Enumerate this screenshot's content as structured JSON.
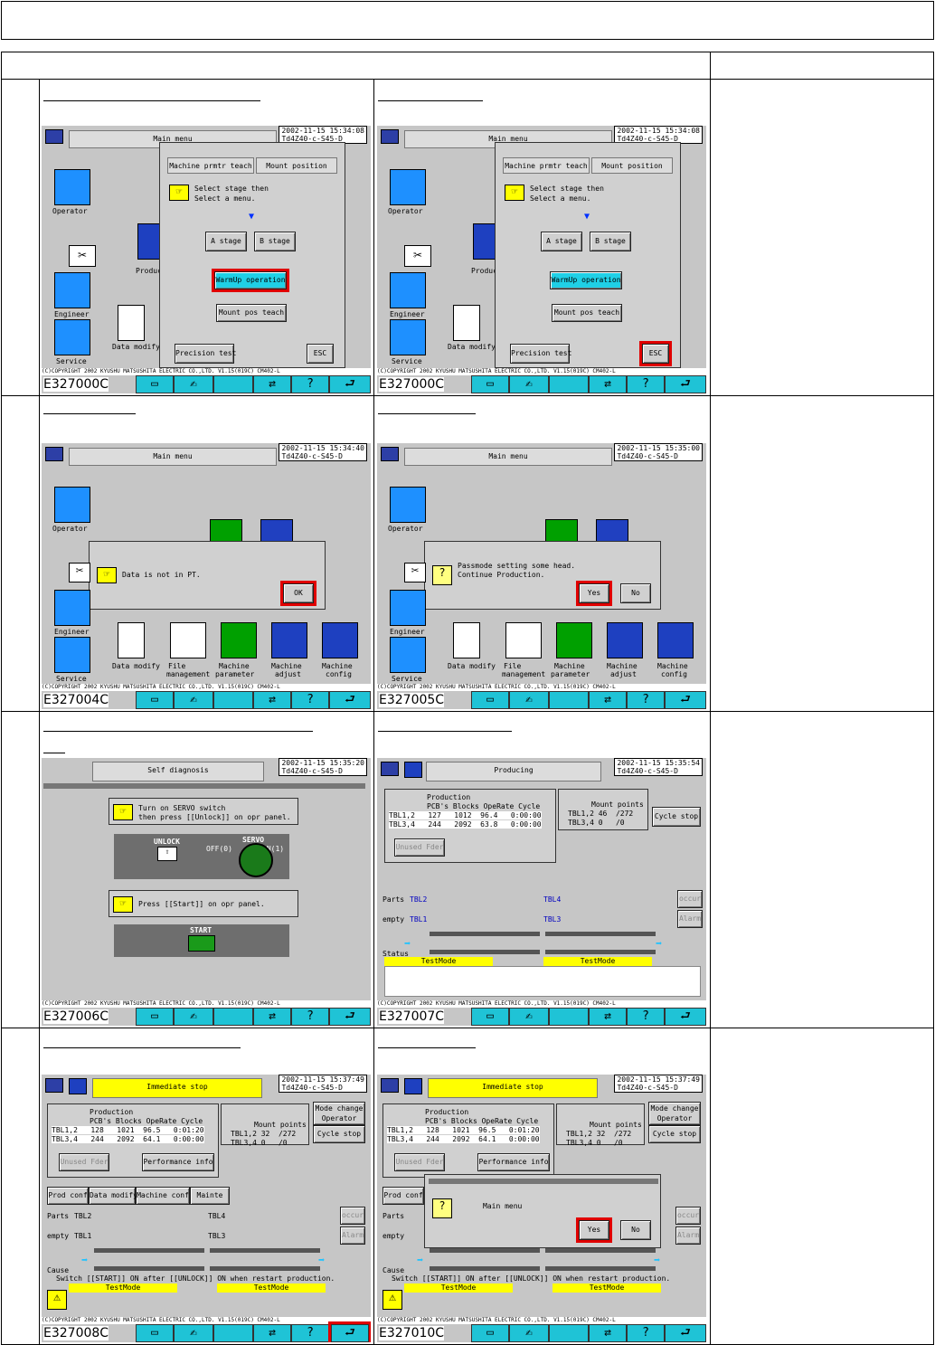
{
  "stamp_date": "2002-11-15",
  "copyright": "(C)COPYRIGHT 2002 KYUSHU MATSUSHITA ELECTRIC CO.,LTD. V1.15(019C)   CM402-L",
  "toolbar": {
    "help": "?",
    "transfer": "⇄",
    "return": "⮐",
    "pen": "✍"
  },
  "screens": [
    {
      "code": "E327000C",
      "time": "15:34:08",
      "file": "Td4Z40-c-S45-D",
      "main": "Main menu",
      "dialog": {
        "left": "Machine prmtr teach",
        "right": "Mount position",
        "msg1": "Select stage then",
        "msg2": "Select a menu.",
        "a": "A stage",
        "b": "B stage",
        "warm": "WarmUp operation",
        "teach": "Mount pos teach",
        "prec": "Precision test",
        "esc": "ESC"
      }
    },
    {
      "code": "E327000C",
      "time": "15:34:08",
      "file": "Td4Z40-c-S45-D",
      "main": "Main menu"
    },
    {
      "code": "E327004C",
      "time": "15:34:40",
      "file": "Td4Z40-c-S45-D",
      "main": "Main menu",
      "msg": "Data is not in PT.",
      "ok": "OK"
    },
    {
      "code": "E327005C",
      "time": "15:35:00",
      "file": "Td4Z40-c-S45-D",
      "main": "Main menu",
      "msg1": "Passmode setting some head.",
      "msg2": "Continue Production.",
      "yes": "Yes",
      "no": "No"
    },
    {
      "code": "E327006C",
      "time": "15:35:20",
      "file": "Td4Z40-c-S45-D",
      "title": "Self diagnosis",
      "msg1": "Turn on SERVO switch",
      "msg2": "then press [[Unlock]] on opr panel.",
      "unlock": "UNLOCK",
      "servo": "SERVO",
      "off": "OFF(0)",
      "on": "ON(1)",
      "msg3": "Press [[Start]] on opr panel.",
      "start": "START"
    },
    {
      "code": "E327007C",
      "time": "15:35:54",
      "file": "Td4Z40-c-S45-D",
      "title": "Producing"
    },
    {
      "code": "E327008C",
      "time": "15:37:49",
      "file": "Td4Z40-c-S45-D",
      "title": "Immediate stop"
    },
    {
      "code": "E327010C",
      "time": "15:37:49",
      "file": "Td4Z40-c-S45-D",
      "title": "Immediate stop",
      "dlgmsg": "Main menu",
      "yes": "Yes",
      "no": "No"
    }
  ],
  "icons": {
    "operator": "Operator",
    "engineer": "Engineer",
    "service": "Service",
    "datamod": "Data modify",
    "file1": "File",
    "file2": "management",
    "mp1": "Machine",
    "mp2": "parameter",
    "ma1": "Machine",
    "ma2": "adjust",
    "mc1": "Machine",
    "mc2": "config",
    "produc": "Produc"
  },
  "prod": {
    "head": "Production",
    "cols": "PCB's Blocks OpeRate Cycle time",
    "r1": "TBL1,2   127   1012  96.4   0:00:00",
    "r2": "TBL3,4   244   2092  63.8   0:00:00",
    "r1b": "TBL1,2   128   1021  96.5   0:01:20",
    "r2b": "TBL3,4   244   2092  64.1   0:00:00",
    "mp": "Mount points",
    "m1": "TBL1,2 46  /272",
    "m2": "TBL3,4 0   /0",
    "m1b": "TBL1,2 32  /272",
    "m2b": "TBL3,4 0   /0",
    "cycle": "Cycle stop",
    "unused": "Unused Fder",
    "perf": "Performance info",
    "mode1": "Mode change",
    "mode2": "Operator",
    "parts": "Parts",
    "empty": "empty",
    "tbl1": "TBL1",
    "tbl2": "TBL2",
    "tbl3": "TBL3",
    "tbl4": "TBL4",
    "occur": "occur",
    "alarm": "Alarm",
    "status": "Status",
    "cause": "Cause",
    "test": "TestMode",
    "prodconf": "Prod conf",
    "datamod": "Data modify",
    "machconf": "Machine conf",
    "mainte": "Mainte",
    "switch": "Switch [[START]] ON after [[UNLOCK]] ON when restart production."
  }
}
